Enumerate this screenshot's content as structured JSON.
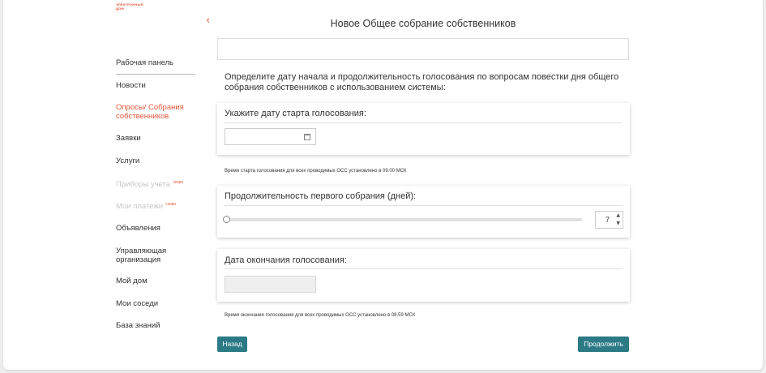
{
  "logo": {
    "line1": "ЭЛЕКТРОННЫЙ",
    "line2": "ДОМ"
  },
  "sidebar": {
    "items": [
      {
        "label": "Рабочая панель"
      },
      {
        "label": "Новости"
      },
      {
        "label": "Опросы/ Собрания собственников"
      },
      {
        "label": "Заявки"
      },
      {
        "label": "Услуги"
      },
      {
        "label": "Приборы учета",
        "badge": "скоро"
      },
      {
        "label": "Мои платежи",
        "badge": "скоро"
      },
      {
        "label": "Объявления"
      },
      {
        "label": "Управляющая организация"
      },
      {
        "label": "Мой дом"
      },
      {
        "label": "Мои соседи"
      },
      {
        "label": "База знаний"
      }
    ]
  },
  "header": {
    "back": "‹",
    "title": "Новое Общее собрание собственников"
  },
  "intro": "Определите дату начала и продолжительность голосования по вопросам повестки дня общего собрания собственников с использованием системы:",
  "start_card": {
    "title": "Укажите дату старта голосования:",
    "value": ""
  },
  "start_note": "Время старта голосования для всех проводимых ОСС установлено в 09.00 МСК",
  "duration_card": {
    "title": "Продолжительность первого собрания (дней):",
    "value": "7",
    "slider_fraction": 0
  },
  "end_card": {
    "title": "Дата окончания голосования:",
    "value": ""
  },
  "end_note": "Время окончания голосования для всех проводимых ОСС установлено в 08.59 МСК",
  "buttons": {
    "back": "Назад",
    "continue": "Продолжить"
  },
  "colors": {
    "accent": "#e8573a",
    "primary": "#2b7a86"
  }
}
